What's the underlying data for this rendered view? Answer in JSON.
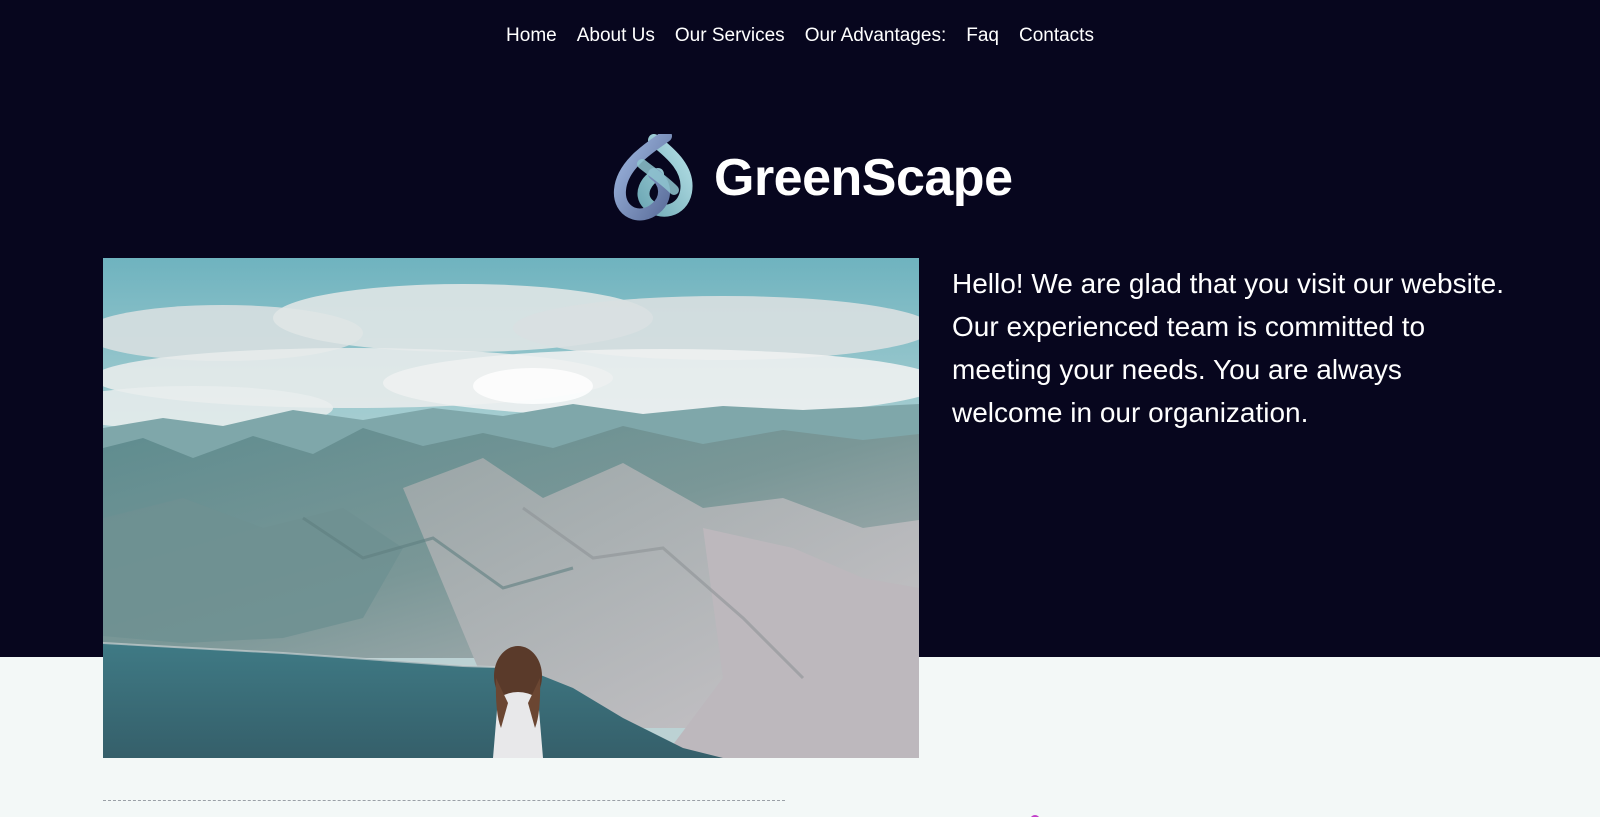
{
  "nav": {
    "items": [
      {
        "label": "Home"
      },
      {
        "label": "About Us"
      },
      {
        "label": "Our Services"
      },
      {
        "label": "Our Advantages:"
      },
      {
        "label": "Faq"
      },
      {
        "label": "Contacts"
      }
    ]
  },
  "brand": {
    "name": "GreenScape",
    "logo_icon": "knot-logo-icon"
  },
  "hero": {
    "image_icon": "mountain-lake-photo",
    "intro_text": "Hello! We are glad that you visit our website. Our experienced team is committed to meeting your needs. You are always welcome in our organization."
  },
  "colors": {
    "header_bg": "#07061e",
    "page_bg": "#f3f8f7",
    "text_light": "#ffffff",
    "logo_blue": "#7f95c9",
    "logo_teal": "#8fc7d0"
  }
}
